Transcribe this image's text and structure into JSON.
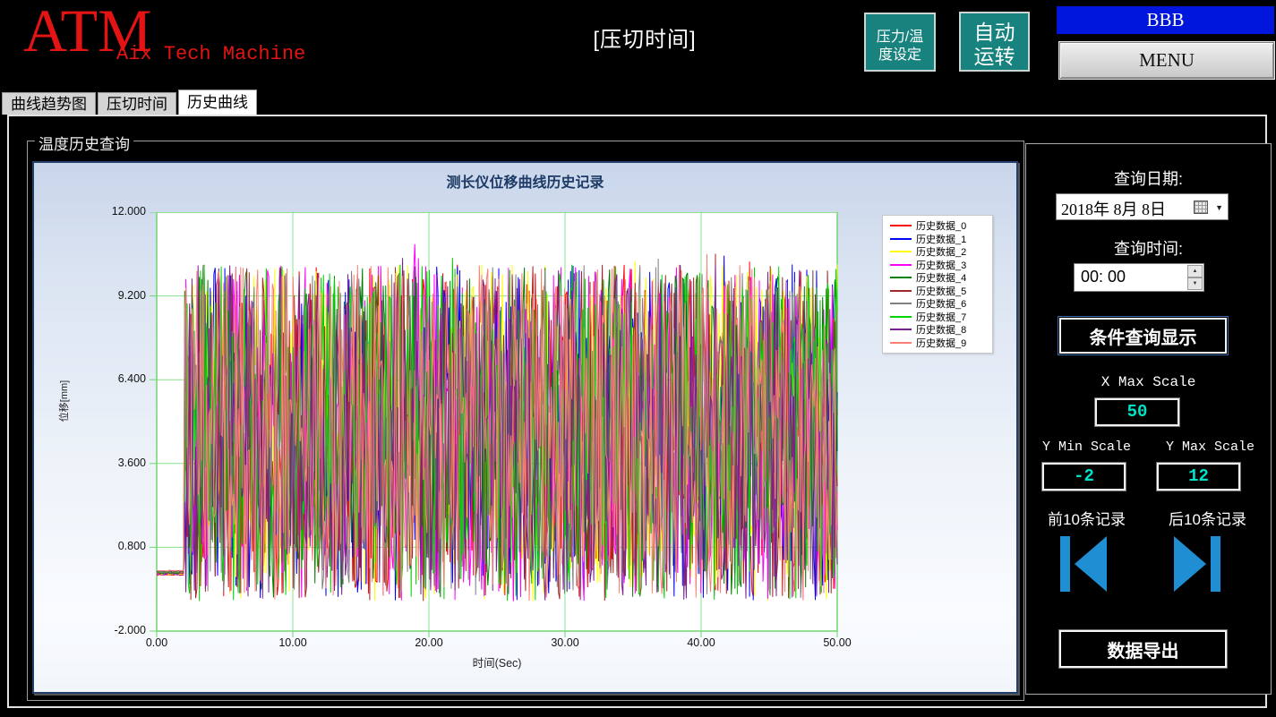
{
  "header": {
    "logo": "ATM",
    "logo_sub": "Aix Tech Machine",
    "page_title": "[压切时间]",
    "pressure_temp_button": [
      "压力/温",
      "度设定"
    ],
    "auto_run_button": [
      "自动",
      "运转"
    ],
    "bbb_label": "BBB",
    "menu_label": "MENU"
  },
  "tabs": [
    {
      "label": "曲线趋势图",
      "active": false
    },
    {
      "label": "压切时间",
      "active": false
    },
    {
      "label": "历史曲线",
      "active": true
    }
  ],
  "group_box": {
    "title": "温度历史查询"
  },
  "chart_data": {
    "type": "line",
    "title": "测长仪位移曲线历史记录",
    "xlabel": "时间(Sec)",
    "ylabel": "位移[mm]",
    "xlim": [
      0,
      50
    ],
    "ylim": [
      -2,
      12
    ],
    "x_ticks_values": [
      0,
      10,
      20,
      30,
      40,
      50
    ],
    "x_ticks": [
      "0.00",
      "10.00",
      "20.00",
      "30.00",
      "40.00",
      "50.00"
    ],
    "y_ticks_values": [
      12,
      9.2,
      6.4,
      3.6,
      0.8,
      -2
    ],
    "y_ticks": [
      "12.000",
      "9.200",
      "6.400",
      "3.600",
      "0.800",
      "-2.000"
    ],
    "grid": true,
    "grid_color": "#8ce08c",
    "axis_color": "#6fd66f",
    "plot_bg": "#ffffff",
    "legend_position": "right-top",
    "series": [
      {
        "name": "历史数据_0",
        "color": "#ff0000"
      },
      {
        "name": "历史数据_1",
        "color": "#0000ff"
      },
      {
        "name": "历史数据_2",
        "color": "#ffff00"
      },
      {
        "name": "历史数据_3",
        "color": "#ff00ff"
      },
      {
        "name": "历史数据_4",
        "color": "#008000"
      },
      {
        "name": "历史数据_5",
        "color": "#a02828"
      },
      {
        "name": "历史数据_6",
        "color": "#808080"
      },
      {
        "name": "历史数据_7",
        "color": "#00d400"
      },
      {
        "name": "历史数据_8",
        "color": "#7a1f8e"
      },
      {
        "name": "历史数据_9",
        "color": "#f98072"
      }
    ],
    "noise": {
      "description": "10 overlapping random displacement traces: flat at about -0.1 mm from t=0 to t≈2 s, then dense oscillation between about -1 and 10.5 mm with rare peaks near 11 mm",
      "seed": 1337,
      "points": 560,
      "flat_until_x": 2.0,
      "flat_value": -0.12,
      "min": -1.0,
      "max": 10.25,
      "peak_chance": 0.05,
      "peak_extra": 1.0
    }
  },
  "right_panel": {
    "query_date_label": "查询日期:",
    "query_date_value": "2018年 8月 8日",
    "query_time_label": "查询时间:",
    "query_time_value": "00: 00",
    "query_button": "条件查询显示",
    "x_max_scale_label": "X Max Scale",
    "x_max_scale_value": "50",
    "y_min_scale_label": "Y Min Scale",
    "y_min_scale_value": "-2",
    "y_max_scale_label": "Y Max Scale",
    "y_max_scale_value": "12",
    "prev_records_label": "前10条记录",
    "next_records_label": "后10条记录",
    "export_button": "数据导出"
  },
  "colors": {
    "logo_red": "#e41414",
    "teal_button": "#17827e",
    "bbb_blue": "#0016dd",
    "accent_cyan": "#00e2c8",
    "arrow_blue": "#1f8ed2",
    "chart_title_navy": "#1e3a66"
  }
}
